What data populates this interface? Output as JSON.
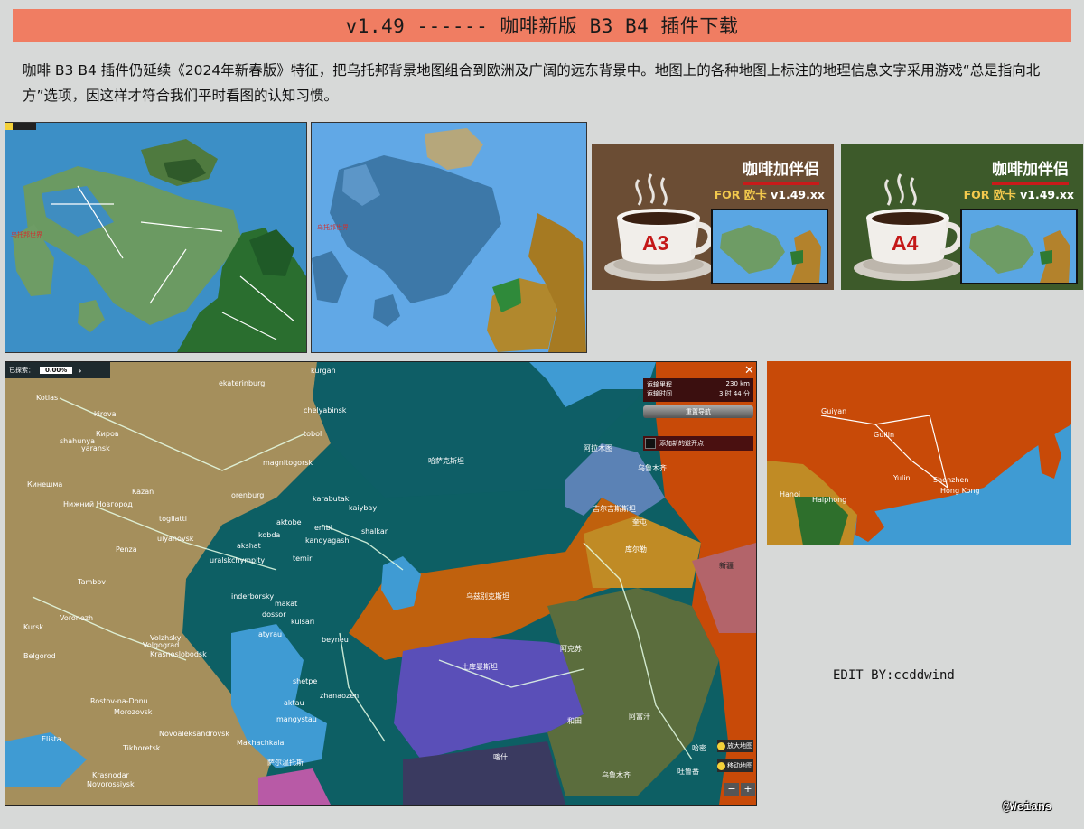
{
  "header": {
    "title": "v1.49 ------ 咖啡新版 B3 B4 插件下载"
  },
  "intro": {
    "text": "咖啡 B3 B4 插件仍延续《2024年新春版》特征，把乌托邦背景地图组合到欧洲及广阔的远东背景中。地图上的各种地图上标注的地理信息文字采用游戏“总是指向北方”选项，因这样才符合我们平时看图的认知习惯。"
  },
  "map_a": {
    "label": "乌托邦世界"
  },
  "map_b": {
    "label": "乌托邦世界"
  },
  "cards": [
    {
      "title": "咖啡加伴侣",
      "for_label": "FOR 欧卡",
      "version": "v1.49.xx",
      "code": "A3"
    },
    {
      "title": "咖啡加伴侣",
      "for_label": "FOR 欧卡",
      "version": "v1.49.xx",
      "code": "A4"
    }
  ],
  "bigmap": {
    "progress_label": "已探索：",
    "progress_value": "0.00%",
    "route": {
      "distance_label": "运输里程",
      "distance_value": "230 km",
      "time_label": "运输时间",
      "time_value": "3 时 44 分",
      "reset_button": "重置导航",
      "add_waypoint_button": "添加新的避开点"
    },
    "side_buttons": [
      "放大地图",
      "移动地图"
    ],
    "regions": [
      "哈萨克斯坦",
      "乌兹别克斯坦",
      "土库曼斯坦",
      "阿富汗",
      "吉尔吉斯斯坦",
      "新疆",
      "乌鲁木齐"
    ],
    "cities": [
      "kurgan",
      "ekaterinburg",
      "chelyabinsk",
      "tobol",
      "magnitogorsk",
      "orenburg",
      "aktobe",
      "kobda",
      "akshat",
      "kandyagash",
      "embi",
      "shalkar",
      "karabutak",
      "kaiybay",
      "uralsk",
      "chympity",
      "zhympity",
      "temir",
      "inderborsky",
      "makat",
      "dossor",
      "kulsari",
      "atyrau",
      "beyneu",
      "shetpe",
      "aktau",
      "zhanaozen",
      "mangystau",
      "Kotlas",
      "kirova",
      "Киров",
      "yaransk",
      "shahunya",
      "Кинешма",
      "Нижний Новгород",
      "Kazan",
      "togliatti",
      "ulyanovsk",
      "Penza",
      "Tambov",
      "Voronezh",
      "Kursk",
      "Belgorod",
      "Volzhsky",
      "Volgograd",
      "Krasnoslobodsk",
      "Rostov-na-Donu",
      "Morozovsk",
      "Novoaleksandrovsk",
      "Makhachkala",
      "Elista",
      "Tikhoretsk",
      "Krasnodar",
      "Novorossiysk",
      "阿拉木图",
      "奎屯",
      "库尔勒",
      "阿克苏",
      "喀什",
      "和田",
      "乌鲁木齐",
      "吐鲁番",
      "哈密",
      "萨尔温托斯"
    ]
  },
  "china_map": {
    "cities": [
      "Guiyan",
      "Guilin",
      "Yulin",
      "Shenzhen",
      "Hong Kong",
      "Hanoi",
      "Haiphong"
    ]
  },
  "footer": {
    "edit_by": "EDIT BY:ccddwind",
    "watermark": "@Weians"
  },
  "colors": {
    "banner": "#f07d62",
    "background": "#d7d9d8",
    "kazakhstan": "#0d5f64",
    "russia": "#a58f5c",
    "uzbekistan": "#5a4fb8",
    "china": "#c84a08"
  }
}
